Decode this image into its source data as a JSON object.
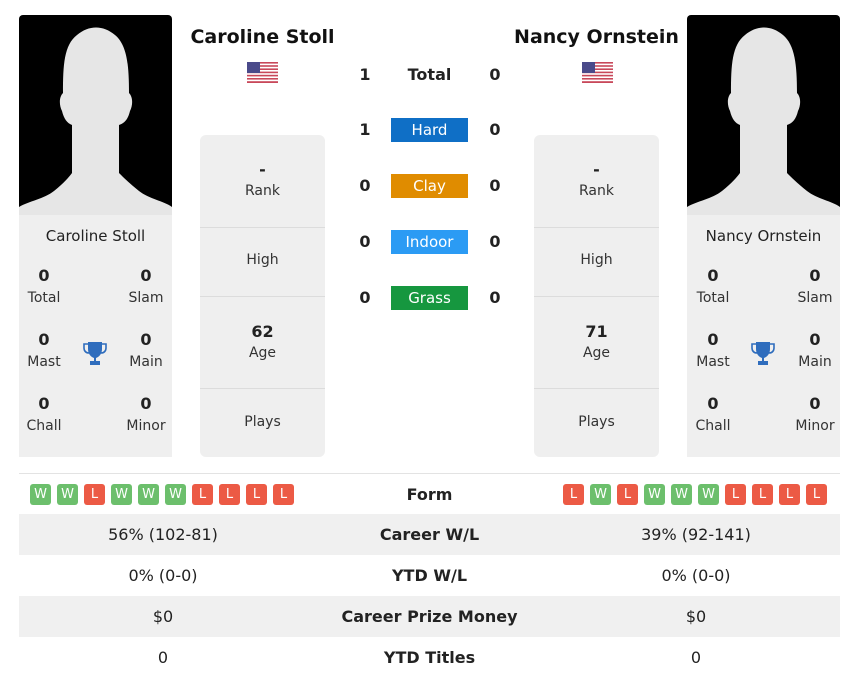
{
  "player1": {
    "name": "Caroline Stoll",
    "card_name": "Caroline Stoll",
    "country_flag": "us-flag",
    "titles": {
      "total": {
        "value": "0",
        "label": "Total"
      },
      "slam": {
        "value": "0",
        "label": "Slam"
      },
      "mast": {
        "value": "0",
        "label": "Mast"
      },
      "main": {
        "value": "0",
        "label": "Main"
      },
      "chall": {
        "value": "0",
        "label": "Chall"
      },
      "minor": {
        "value": "0",
        "label": "Minor"
      }
    },
    "info": {
      "rank": {
        "value": "-",
        "label": "Rank"
      },
      "high": {
        "value": "",
        "label": "High"
      },
      "age": {
        "value": "62",
        "label": "Age"
      },
      "plays": {
        "value": "",
        "label": "Plays"
      }
    },
    "form": [
      "W",
      "W",
      "L",
      "W",
      "W",
      "W",
      "L",
      "L",
      "L",
      "L"
    ]
  },
  "player2": {
    "name": "Nancy Ornstein",
    "card_name": "Nancy Ornstein",
    "country_flag": "us-flag",
    "titles": {
      "total": {
        "value": "0",
        "label": "Total"
      },
      "slam": {
        "value": "0",
        "label": "Slam"
      },
      "mast": {
        "value": "0",
        "label": "Mast"
      },
      "main": {
        "value": "0",
        "label": "Main"
      },
      "chall": {
        "value": "0",
        "label": "Chall"
      },
      "minor": {
        "value": "0",
        "label": "Minor"
      }
    },
    "info": {
      "rank": {
        "value": "-",
        "label": "Rank"
      },
      "high": {
        "value": "",
        "label": "High"
      },
      "age": {
        "value": "71",
        "label": "Age"
      },
      "plays": {
        "value": "",
        "label": "Plays"
      }
    },
    "form": [
      "L",
      "W",
      "L",
      "W",
      "W",
      "W",
      "L",
      "L",
      "L",
      "L"
    ]
  },
  "h2h": {
    "total": {
      "label": "Total",
      "p1": "1",
      "p2": "0"
    },
    "surfaces": [
      {
        "label": "Hard",
        "p1": "1",
        "p2": "0",
        "color": "#0f6fc6"
      },
      {
        "label": "Clay",
        "p1": "0",
        "p2": "0",
        "color": "#e08c00"
      },
      {
        "label": "Indoor",
        "p1": "0",
        "p2": "0",
        "color": "#2b9bf4"
      },
      {
        "label": "Grass",
        "p1": "0",
        "p2": "0",
        "color": "#16973f"
      }
    ]
  },
  "form_label": "Form",
  "comparison": [
    {
      "label": "Career W/L",
      "p1": "56% (102-81)",
      "p2": "39% (92-141)"
    },
    {
      "label": "YTD W/L",
      "p1": "0% (0-0)",
      "p2": "0% (0-0)"
    },
    {
      "label": "Career Prize Money",
      "p1": "$0",
      "p2": "$0"
    },
    {
      "label": "YTD Titles",
      "p1": "0",
      "p2": "0"
    }
  ]
}
